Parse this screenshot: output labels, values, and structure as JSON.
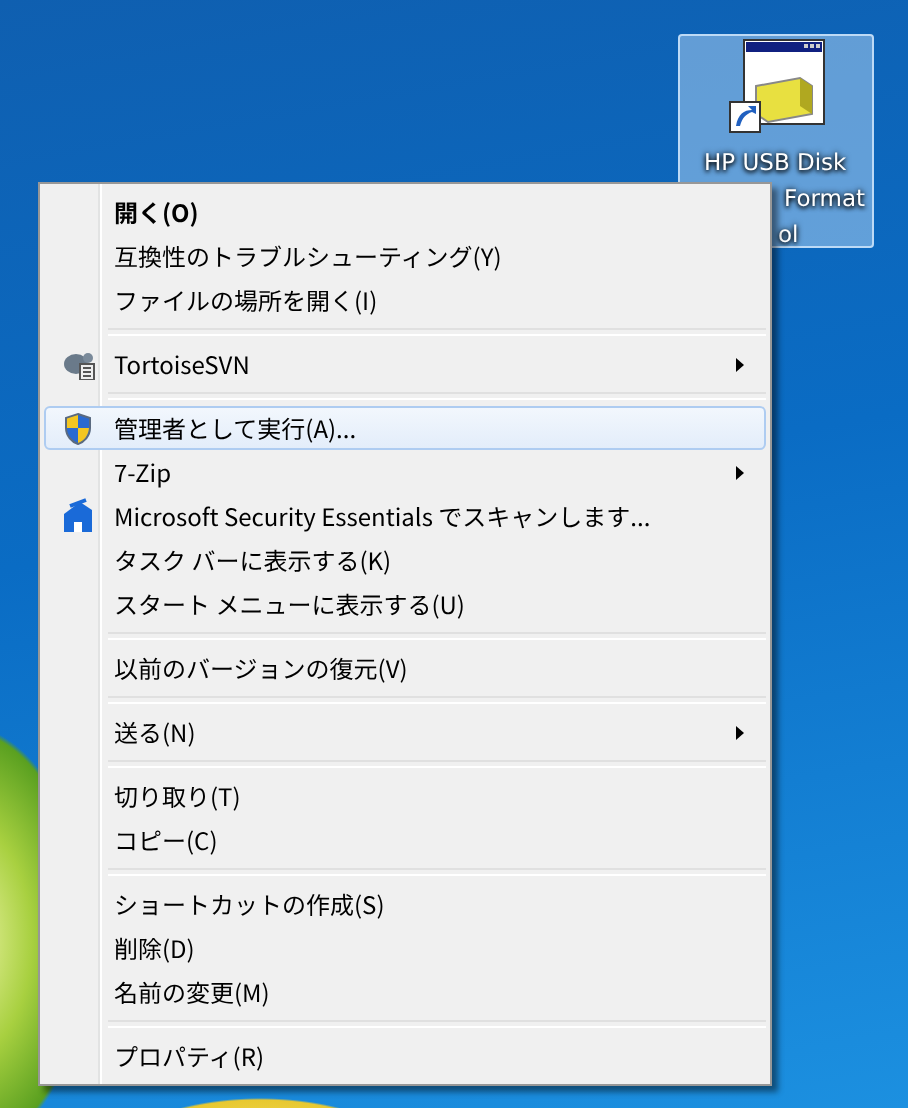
{
  "desktop_icon": {
    "selected": true,
    "label_lines": [
      "HP USB Disk",
      "Format",
      "ol"
    ]
  },
  "context_menu": {
    "groups": [
      [
        {
          "label": "開く(O)",
          "kind": "plain",
          "default": true,
          "selected": false,
          "submenu": false
        },
        {
          "label": "互換性のトラブルシューティング(Y)",
          "kind": "plain",
          "default": false,
          "selected": false,
          "submenu": false
        },
        {
          "label": "ファイルの場所を開く(I)",
          "kind": "plain",
          "default": false,
          "selected": false,
          "submenu": false
        }
      ],
      [
        {
          "label": "TortoiseSVN",
          "kind": "svn",
          "default": false,
          "selected": false,
          "submenu": true
        }
      ],
      [
        {
          "label": "管理者として実行(A)...",
          "kind": "uac",
          "default": false,
          "selected": true,
          "submenu": false
        },
        {
          "label": "7-Zip",
          "kind": "plain",
          "default": false,
          "selected": false,
          "submenu": true
        },
        {
          "label": "Microsoft Security Essentials でスキャンします...",
          "kind": "antivirus",
          "default": false,
          "selected": false,
          "submenu": false
        },
        {
          "label": "タスク バーに表示する(K)",
          "kind": "plain",
          "default": false,
          "selected": false,
          "submenu": false
        },
        {
          "label": "スタート メニューに表示する(U)",
          "kind": "plain",
          "default": false,
          "selected": false,
          "submenu": false
        }
      ],
      [
        {
          "label": "以前のバージョンの復元(V)",
          "kind": "plain",
          "default": false,
          "selected": false,
          "submenu": false
        }
      ],
      [
        {
          "label": "送る(N)",
          "kind": "plain",
          "default": false,
          "selected": false,
          "submenu": true
        }
      ],
      [
        {
          "label": "切り取り(T)",
          "kind": "plain",
          "default": false,
          "selected": false,
          "submenu": false
        },
        {
          "label": "コピー(C)",
          "kind": "plain",
          "default": false,
          "selected": false,
          "submenu": false
        }
      ],
      [
        {
          "label": "ショートカットの作成(S)",
          "kind": "plain",
          "default": false,
          "selected": false,
          "submenu": false
        },
        {
          "label": "削除(D)",
          "kind": "plain",
          "default": false,
          "selected": false,
          "submenu": false
        },
        {
          "label": "名前の変更(M)",
          "kind": "plain",
          "default": false,
          "selected": false,
          "submenu": false
        }
      ],
      [
        {
          "label": "プロパティ(R)",
          "kind": "plain",
          "default": false,
          "selected": false,
          "submenu": false
        }
      ]
    ]
  }
}
